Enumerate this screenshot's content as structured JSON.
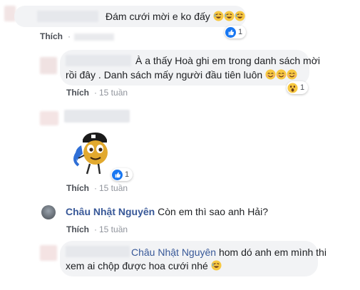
{
  "comments": [
    {
      "text": "Đám cưới mời e ko đấy",
      "emoji": "rofl-emoji",
      "actions": {
        "like": "Thích",
        "time": ""
      },
      "reaction": {
        "icon": "like-reaction-icon",
        "count": "1"
      }
    },
    {
      "lines": [
        "À a thấy Hoà ghi em trong danh sách mời",
        "rồi đây . Danh sách mấy người đầu tiên luôn"
      ],
      "emoji": "smile-emoji",
      "actions": {
        "like": "Thích",
        "time": "15 tuần"
      },
      "reaction": {
        "icon": "wow-reaction-icon",
        "count": "1"
      }
    },
    {
      "sticker": "sticker-image",
      "actions": {
        "like": "Thích",
        "time": "15 tuần"
      },
      "reaction": {
        "icon": "like-reaction-icon",
        "count": "1"
      }
    },
    {
      "author": "Châu Nhật Nguyên",
      "text": "Còn em thì sao anh Hải?",
      "actions": {
        "like": "Thích",
        "time": "15 tuần"
      }
    },
    {
      "mention": "Châu Nhật Nguyên",
      "line1": "hom dó anh em mình thi",
      "line2": "xem ai chộp được hoa cưới nhé",
      "emoji": "rofl-emoji",
      "actions": {
        "like": "Thích",
        "time": "15 tuần"
      }
    }
  ],
  "colors": {
    "link": "#385898",
    "bubble": "#f2f3f5",
    "meta": "#90949c",
    "like_blue": "#1877f2"
  }
}
